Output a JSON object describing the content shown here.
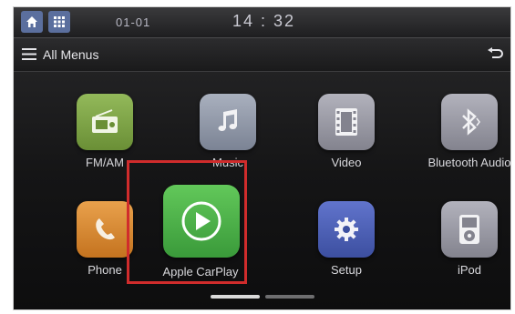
{
  "status_bar": {
    "date": "01-01",
    "time": "14 : 32"
  },
  "header": {
    "title": "All Menus"
  },
  "apps": [
    {
      "label": "FM/AM",
      "icon": "radio-icon",
      "color": "#7fa544"
    },
    {
      "label": "Music",
      "icon": "music-note-icon",
      "color": "#9098a8"
    },
    {
      "label": "Video",
      "icon": "film-icon",
      "color": "#9a9aa6"
    },
    {
      "label": "Bluetooth Audio",
      "icon": "bluetooth-icon",
      "color": "#9a9aa6"
    },
    {
      "label": "Phone",
      "icon": "phone-handset-icon",
      "color": "#d88a34"
    },
    {
      "label": "Apple CarPlay",
      "icon": "carplay-play-icon",
      "color": "#4cb84c"
    },
    {
      "label": "Setup",
      "icon": "gear-icon",
      "color": "#4f63b8"
    },
    {
      "label": "iPod",
      "icon": "ipod-icon",
      "color": "#9a9aa6"
    }
  ],
  "colors": {
    "highlight_border": "#d02c2c",
    "top_button": "#5b6f9e"
  }
}
